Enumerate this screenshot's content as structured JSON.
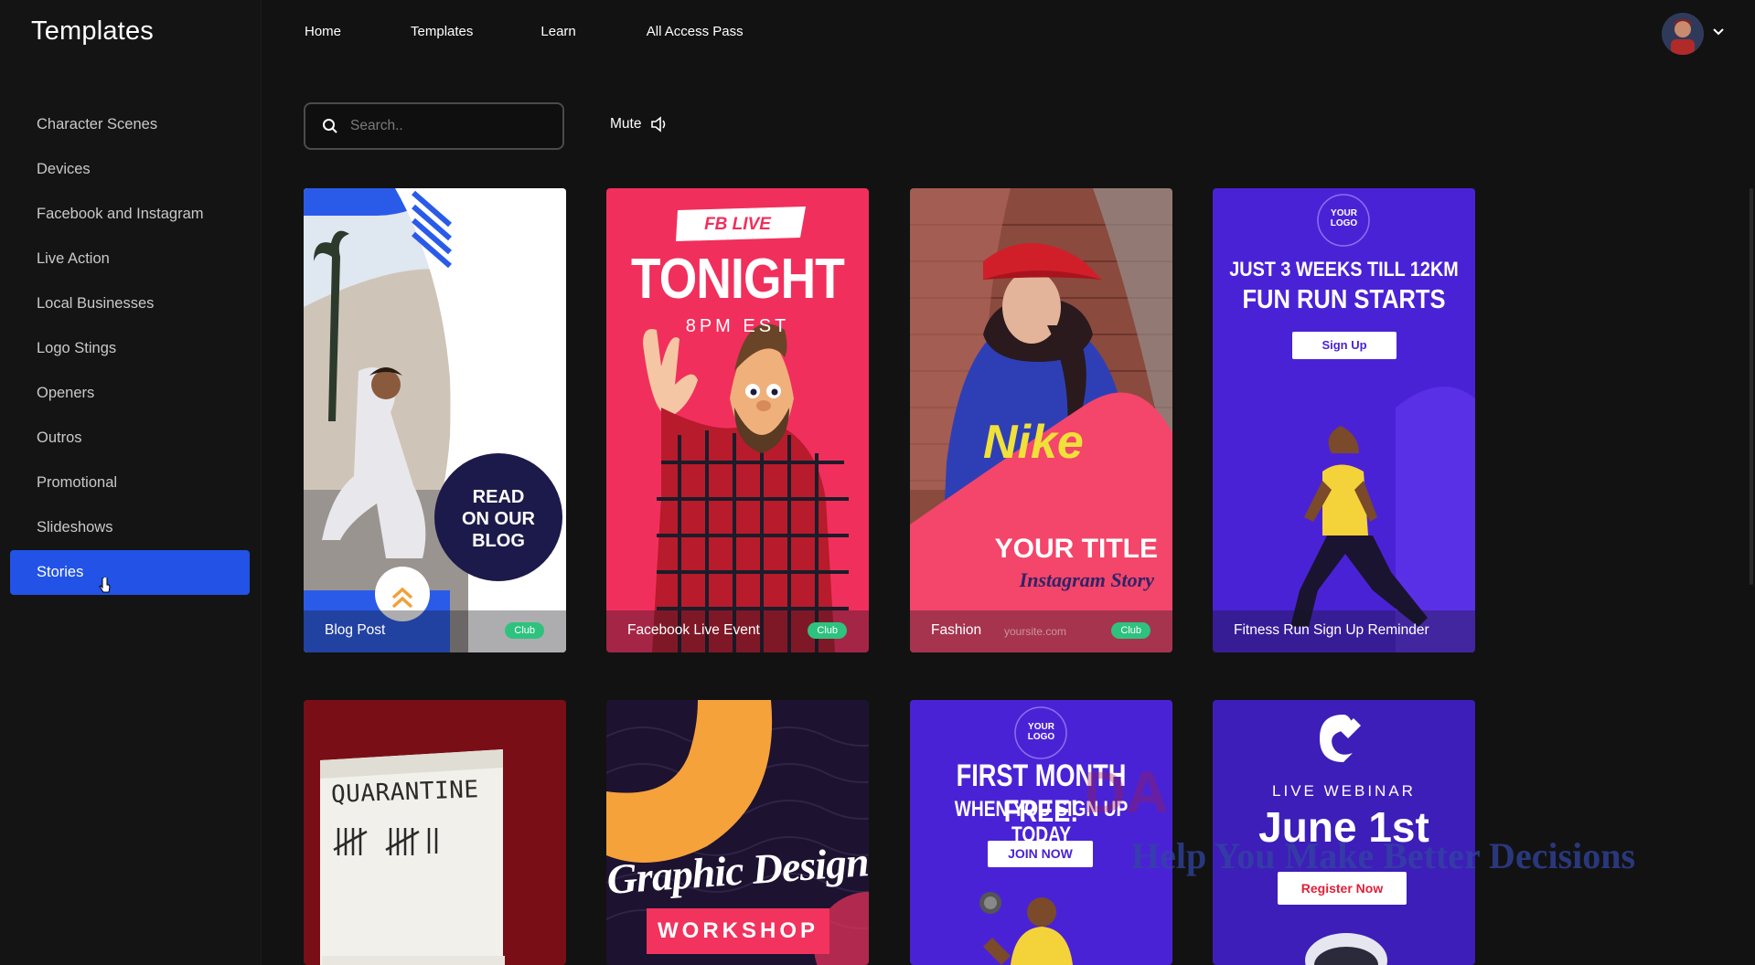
{
  "app": {
    "title": "Templates"
  },
  "topnav": {
    "items": [
      "Home",
      "Templates",
      "Learn",
      "All Access Pass"
    ]
  },
  "sidebar": {
    "items": [
      {
        "label": "Character Scenes"
      },
      {
        "label": "Devices"
      },
      {
        "label": "Facebook and Instagram"
      },
      {
        "label": "Live Action"
      },
      {
        "label": "Local Businesses"
      },
      {
        "label": "Logo Stings"
      },
      {
        "label": "Openers"
      },
      {
        "label": "Outros"
      },
      {
        "label": "Promotional"
      },
      {
        "label": "Slideshows"
      },
      {
        "label": "Stories"
      }
    ],
    "active": "Stories"
  },
  "search": {
    "placeholder": "Search.."
  },
  "mute": {
    "label": "Mute"
  },
  "badge": "Club",
  "cards": [
    {
      "title": "Blog Post",
      "club": true,
      "overlay": [
        "READ",
        "ON OUR",
        "BLOG"
      ]
    },
    {
      "title": "Facebook Live Event",
      "club": true,
      "overlay": [
        "FB LIVE",
        "TONIGHT",
        "8PM EST"
      ]
    },
    {
      "title": "Fashion",
      "club": true,
      "overlay": [
        "YOUR TITLE",
        "Instagram Story",
        "yoursite.com",
        "Nike"
      ]
    },
    {
      "title": "Fitness Run Sign Up Reminder",
      "club": false,
      "overlay": [
        "YOUR",
        "LOGO",
        "JUST 3 WEEKS TILL 12KM",
        "FUN RUN STARTS",
        "Sign Up"
      ]
    },
    {
      "overlay": [
        "QUARANTINE"
      ]
    },
    {
      "overlay": [
        "Graphic Design",
        "WORKSHOP"
      ]
    },
    {
      "overlay": [
        "YOUR",
        "LOGO",
        "FIRST MONTH FREE!",
        "WHEN YOU SIGN UP TODAY",
        "JOIN NOW"
      ]
    },
    {
      "overlay": [
        "LIVE WEBINAR",
        "June 1st",
        "Register Now"
      ]
    }
  ],
  "watermark": {
    "text": "Help You Make Better Decisions",
    "big": "DA"
  },
  "colors": {
    "accent": "#2252e6",
    "club": "#2ec27e",
    "background": "#121212"
  }
}
